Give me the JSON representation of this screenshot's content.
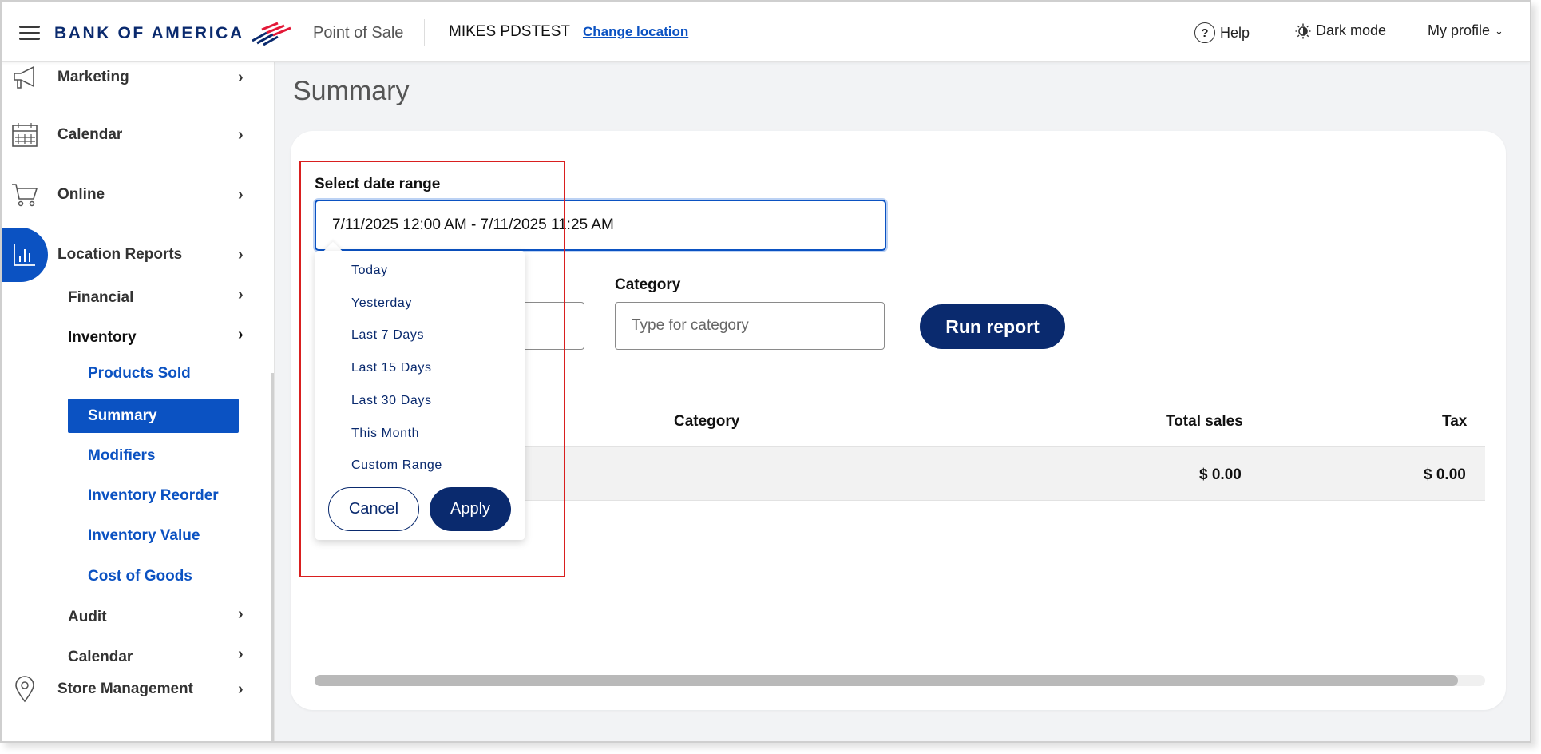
{
  "header": {
    "brand": "BANK OF AMERICA",
    "app_name": "Point of Sale",
    "location": "MIKES PDSTEST",
    "change_location": "Change location",
    "help": "Help",
    "dark_mode": "Dark mode",
    "my_profile": "My profile"
  },
  "sidebar": {
    "items": [
      {
        "label": "Marketing",
        "icon": "megaphone-icon"
      },
      {
        "label": "Calendar",
        "icon": "calendar-icon"
      },
      {
        "label": "Online",
        "icon": "cart-icon"
      },
      {
        "label": "Location Reports",
        "icon": "bar-chart-icon"
      },
      {
        "label": "Store Management",
        "icon": "map-pin-icon"
      }
    ],
    "sub_items": [
      "Financial",
      "Inventory",
      "Audit",
      "Calendar"
    ],
    "inventory_items": [
      "Products Sold",
      "Summary",
      "Modifiers",
      "Inventory Reorder",
      "Inventory Value",
      "Cost of Goods"
    ]
  },
  "main": {
    "page_title": "Summary",
    "date_range_label": "Select date range",
    "date_range_value": "7/11/2025 12:00 AM - 7/11/2025 11:25 AM",
    "category_label": "Category",
    "category_placeholder": "Type for category",
    "run_report": "Run report",
    "table": {
      "headers": [
        "Category",
        "Total sales",
        "Tax"
      ],
      "row": {
        "total_sales": "$ 0.00",
        "tax": "$ 0.00"
      }
    }
  },
  "dropdown": {
    "options": [
      "Today",
      "Yesterday",
      "Last 7 Days",
      "Last 15 Days",
      "Last 30 Days",
      "This Month",
      "Custom Range"
    ],
    "cancel": "Cancel",
    "apply": "Apply"
  },
  "colors": {
    "brand_navy": "#0a2a6e",
    "accent_blue": "#0b52c2",
    "highlight_red": "#d91f1f"
  }
}
